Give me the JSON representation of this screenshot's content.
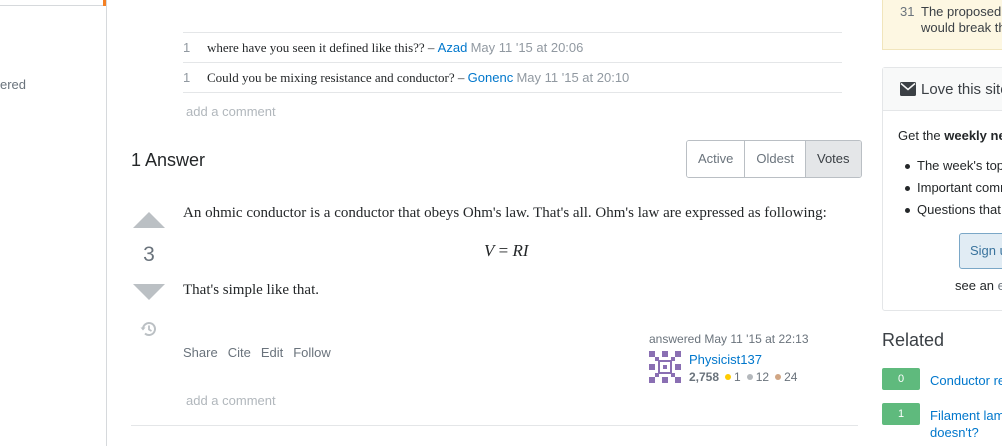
{
  "left_nav": {
    "fragment": "ered"
  },
  "question_comments": [
    {
      "score": "1",
      "text": "where have you seen it defined like this?? – ",
      "user": "Azad",
      "date": "May 11 '15 at 20:06"
    },
    {
      "score": "1",
      "text": "Could you be mixing resistance and conductor? – ",
      "user": "Gonenc",
      "date": "May 11 '15 at 20:10"
    }
  ],
  "question_add_comment": "add a comment",
  "answers_header": {
    "count_label": "1 Answer",
    "sort_tabs": [
      "Active",
      "Oldest",
      "Votes"
    ],
    "selected_tab": "Votes"
  },
  "answer": {
    "vote_count": "3",
    "paragraph_1": "An ohmic conductor is a conductor that obeys Ohm's law. That's all. Ohm's law are expressed as following:",
    "math": {
      "lhs": "V",
      "eq": " = ",
      "rhs": "RI"
    },
    "paragraph_2": "That's simple like that.",
    "menu": [
      "Share",
      "Cite",
      "Edit",
      "Follow"
    ],
    "user_action": "answered May 11 '15 at 22:13",
    "user_name": "Physicist137",
    "reputation": "2,758",
    "badges": {
      "gold": "1",
      "silver": "12",
      "bronze": "24"
    },
    "add_comment": "add a comment"
  },
  "sidebar": {
    "featured": {
      "number": "31",
      "line1": "The proposed",
      "line2": "would break th"
    },
    "newsletter": {
      "title": "Love this site",
      "intro_prefix": "Get the ",
      "intro_bold": "weekly ne",
      "items": [
        "The week's top",
        "Important comm",
        "Questions that"
      ],
      "signup_label": "Sign u",
      "see_prefix": "see an ",
      "see_link": "e"
    },
    "related_title": "Related",
    "related": [
      {
        "score": "0",
        "title_line1": "Conductor re",
        "title_line2": ""
      },
      {
        "score": "1",
        "title_line1": "Filament lam",
        "title_line2": "doesn't?"
      }
    ]
  },
  "colors": {
    "link": "#0077cc",
    "accepted_green": "#5fba7d",
    "featured_bg": "#fdf7e2"
  }
}
